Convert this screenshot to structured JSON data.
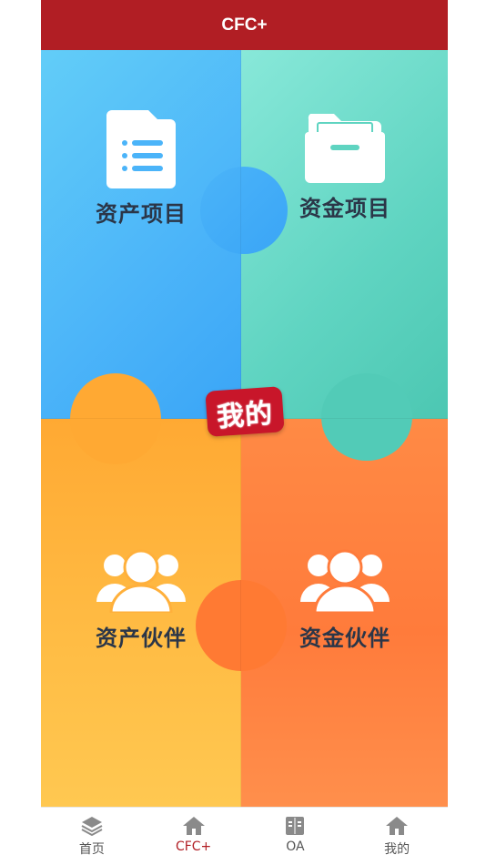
{
  "header": {
    "title": "CFC+"
  },
  "tiles": [
    {
      "id": "asset-project",
      "label": "资产项目",
      "icon": "file-list-icon"
    },
    {
      "id": "fund-project",
      "label": "资金项目",
      "icon": "folder-icon"
    },
    {
      "id": "asset-partner",
      "label": "资产伙伴",
      "icon": "users-icon"
    },
    {
      "id": "fund-partner",
      "label": "资金伙伴",
      "icon": "users-icon"
    }
  ],
  "center_badge": {
    "label": "我的"
  },
  "tabbar": {
    "items": [
      {
        "label": "首页",
        "icon": "layers-icon",
        "active": false
      },
      {
        "label": "CFC+",
        "icon": "home-icon",
        "active": true
      },
      {
        "label": "OA",
        "icon": "book-icon",
        "active": false
      },
      {
        "label": "我的",
        "icon": "home-icon",
        "active": false
      }
    ]
  },
  "colors": {
    "header": "#b11e24",
    "blue": "#4bb4f9",
    "teal": "#5fd4c1",
    "yellow": "#ffb03b",
    "orange": "#ff7b3b",
    "active_tab": "#b11e24"
  }
}
